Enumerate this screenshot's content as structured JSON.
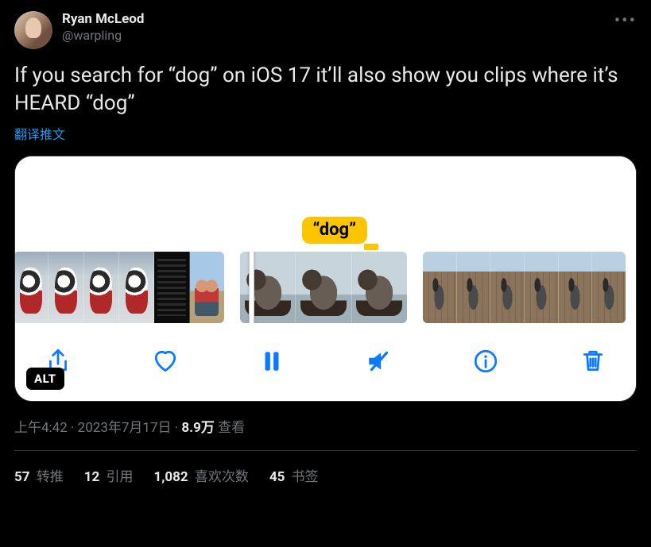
{
  "user": {
    "display_name": "Ryan McLeod",
    "handle": "@warpling"
  },
  "tweet_text": "If you search for “dog” on iOS 17 it’ll also show you clips where it’s HEARD “dog”",
  "translate_label": "翻译推文",
  "media": {
    "search_tag": "“dog”",
    "alt_badge": "ALT"
  },
  "meta": {
    "time": "上午4:42",
    "dot1": " · ",
    "date": "2023年7月17日",
    "dot2": " · ",
    "views_count": "8.9万",
    "views_label": " 查看"
  },
  "stats": {
    "retweets_count": "57",
    "retweets_label": " 转推",
    "quotes_count": "12",
    "quotes_label": " 引用",
    "likes_count": "1,082",
    "likes_label": " 喜欢次数",
    "bookmarks_count": "45",
    "bookmarks_label": " 书签"
  }
}
